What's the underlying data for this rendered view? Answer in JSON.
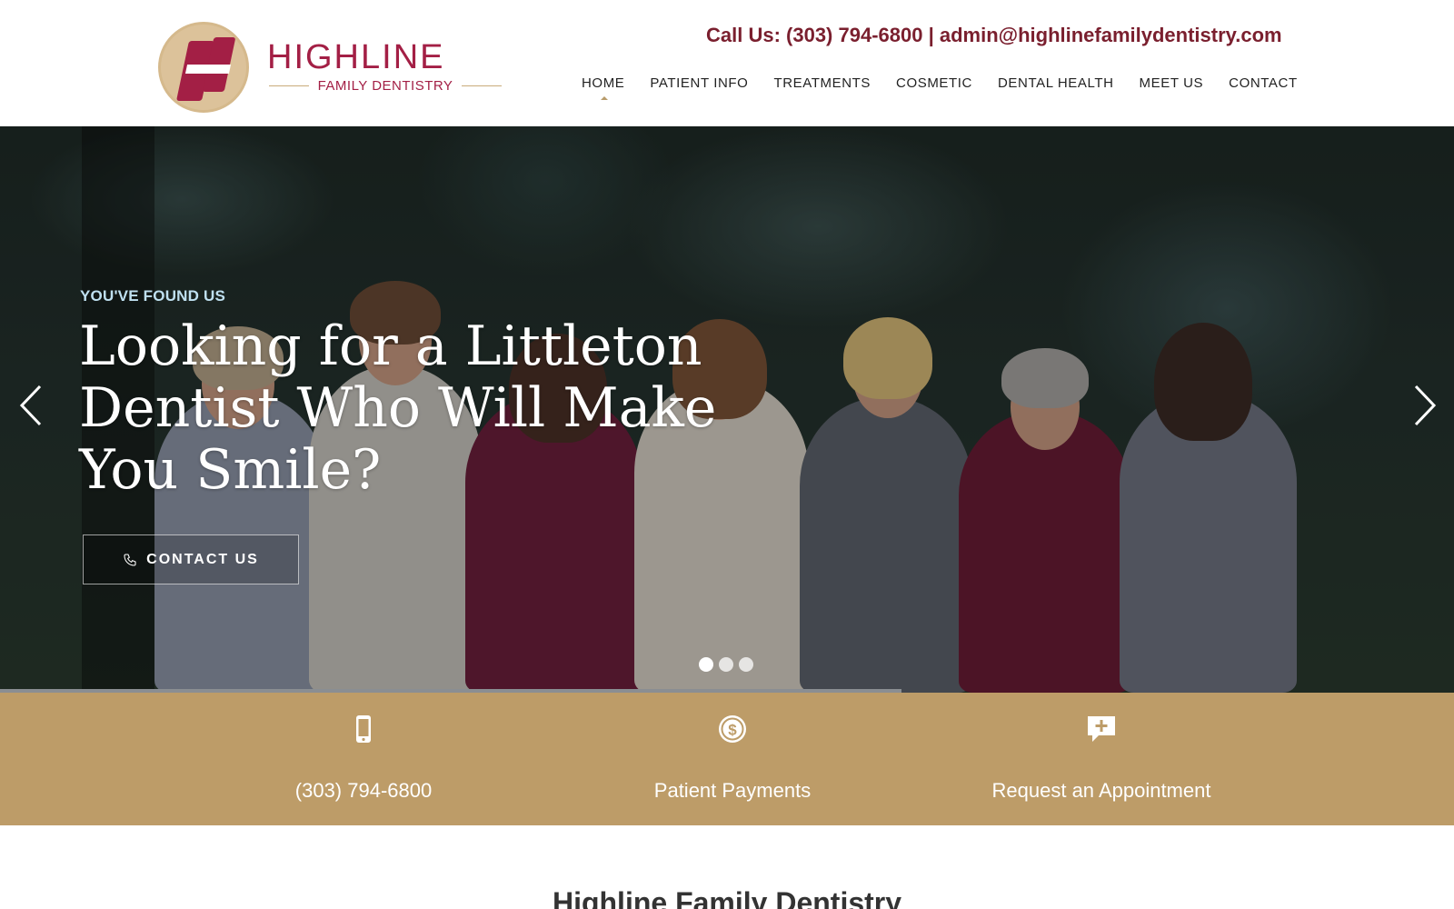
{
  "header": {
    "logo": {
      "name": "HIGHLINE",
      "subtitle": "FAMILY DENTISTRY"
    },
    "contact_line": "Call Us: (303) 794-6800 | admin@highlinefamilydentistry.com",
    "nav": [
      {
        "label": "HOME",
        "active": true
      },
      {
        "label": "PATIENT INFO",
        "active": false
      },
      {
        "label": "TREATMENTS",
        "active": false
      },
      {
        "label": "COSMETIC",
        "active": false
      },
      {
        "label": "DENTAL HEALTH",
        "active": false
      },
      {
        "label": "MEET US",
        "active": false
      },
      {
        "label": "CONTACT",
        "active": false
      }
    ]
  },
  "hero": {
    "eyebrow": "YOU'VE FOUND US",
    "title": "Looking for a Littleton Dentist Who Will Make You Smile?",
    "cta_label": "CONTACT US",
    "cta_icon": "phone-icon",
    "prev_icon": "chevron-left-icon",
    "next_icon": "chevron-right-icon",
    "slides_total": 3,
    "active_slide": 1,
    "slide_progress": 0.62
  },
  "quick_links": [
    {
      "label": "(303) 794-6800",
      "icon": "mobile-phone-icon"
    },
    {
      "label": "Patient Payments",
      "icon": "dollar-circle-icon"
    },
    {
      "label": "Request an Appointment",
      "icon": "chat-plus-icon"
    }
  ],
  "section": {
    "title": "Highline Family Dentistry"
  },
  "colors": {
    "brand_maroon": "#a31f45",
    "contact_text": "#7a1f2e",
    "gold_bar": "#bd9c68",
    "eyebrow": "#bfe0f0"
  }
}
